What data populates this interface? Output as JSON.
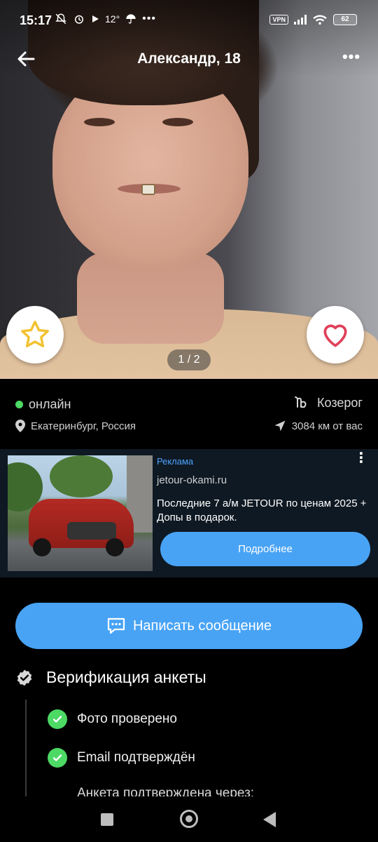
{
  "status_bar": {
    "time": "15:17",
    "temperature": "12°",
    "vpn": "VPN",
    "battery": "62"
  },
  "header": {
    "title": "Александр, 18",
    "photo_pager": "1 / 2"
  },
  "profile": {
    "status": "онлайн",
    "zodiac": "Козерог",
    "location": "Екатеринбург, Россия",
    "distance": "3084 км от вас"
  },
  "ad": {
    "label": "Реклама",
    "domain": "jetour-okami.ru",
    "text": "Последние 7 а/м JETOUR по ценам 2025 + Допы в подарок.",
    "button": "Подробнее"
  },
  "actions": {
    "message_button": "Написать сообщение"
  },
  "verification": {
    "title": "Верификация анкеты",
    "items": [
      "Фото проверено",
      "Email подтверждён",
      "Анкета подтверждена через:"
    ]
  },
  "colors": {
    "accent": "#48a3f5",
    "online": "#4cd964",
    "like": "#e0405a",
    "star": "#f2c230"
  }
}
